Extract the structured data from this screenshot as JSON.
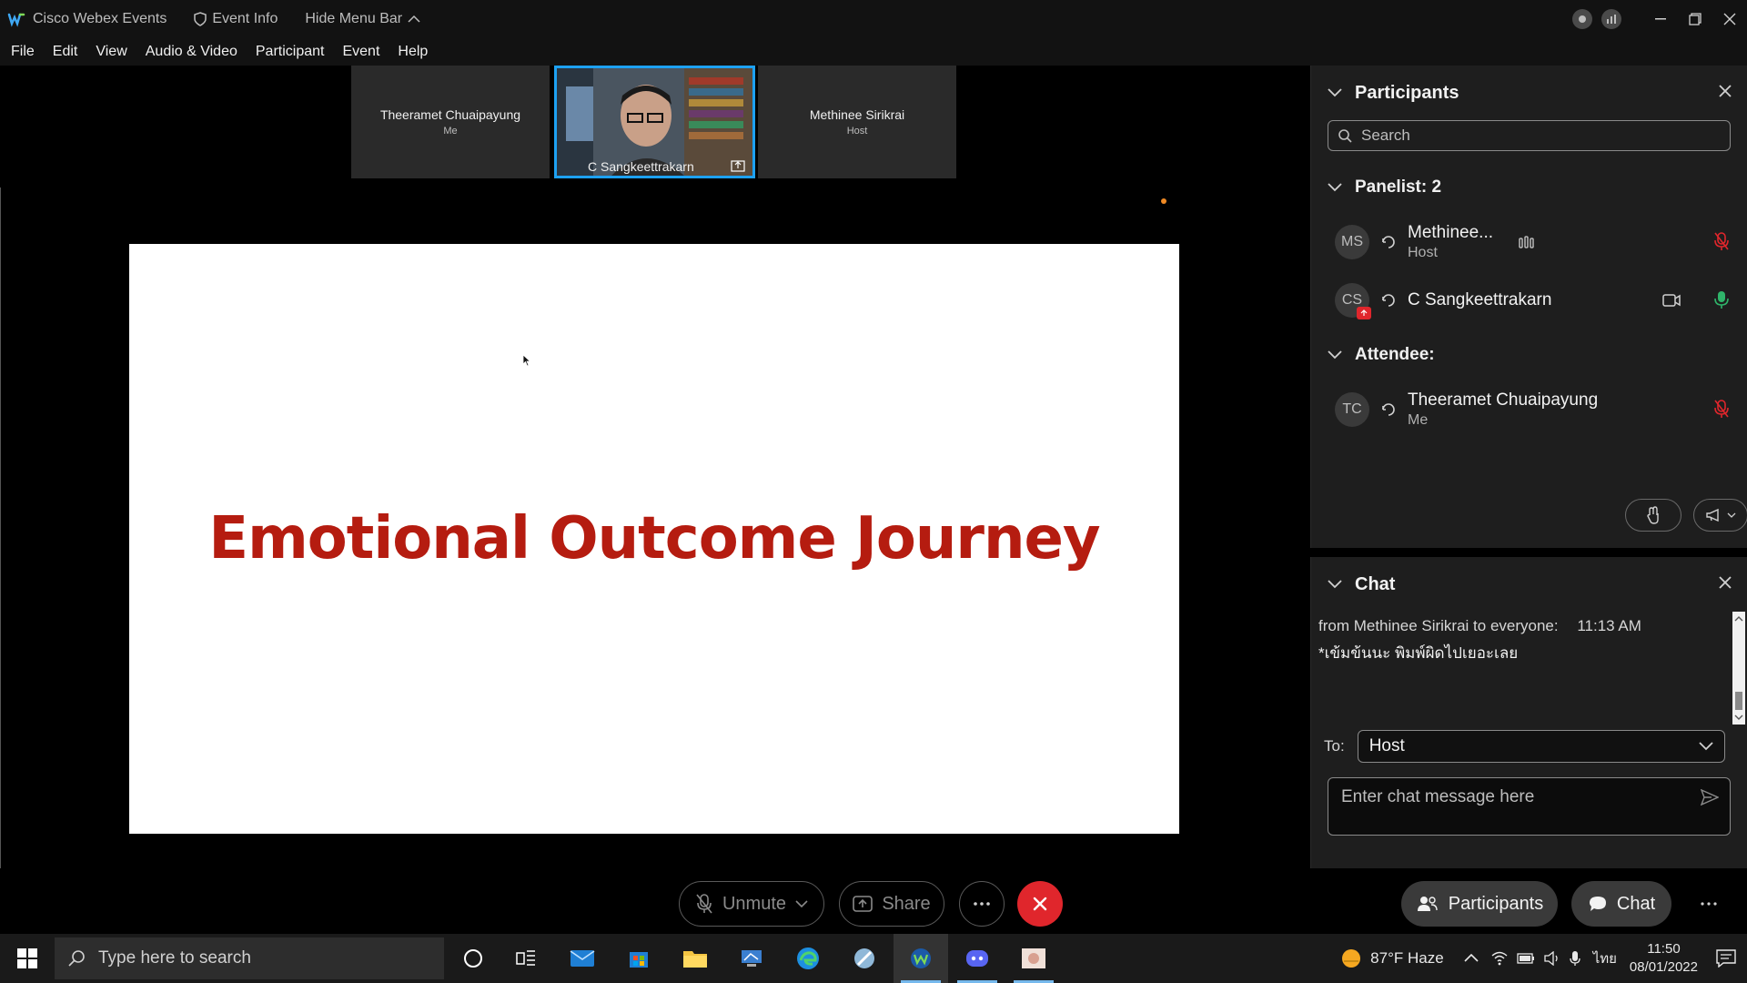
{
  "titlebar": {
    "app_name": "Cisco Webex Events",
    "event_info": "Event Info",
    "hide_menu": "Hide Menu Bar"
  },
  "menu": [
    "File",
    "Edit",
    "View",
    "Audio & Video",
    "Participant",
    "Event",
    "Help"
  ],
  "video_tiles": [
    {
      "name": "Theeramet Chuaipayung",
      "sub": "Me"
    },
    {
      "name": "C Sangkeettrakarn",
      "sub": ""
    },
    {
      "name": "Methinee Sirikrai",
      "sub": "Host"
    }
  ],
  "slide": {
    "title": "Emotional Outcome Journey"
  },
  "controls": {
    "unmute": "Unmute",
    "share": "Share",
    "participants": "Participants",
    "chat": "Chat"
  },
  "participants_panel": {
    "title": "Participants",
    "search_placeholder": "Search",
    "panelist_header": "Panelist: 2",
    "attendee_header": "Attendee:",
    "panelists": [
      {
        "initials": "MS",
        "name": "Methinee...",
        "role": "Host"
      },
      {
        "initials": "CS",
        "name": "C Sangkeettrakarn",
        "role": ""
      }
    ],
    "attendees": [
      {
        "initials": "TC",
        "name": "Theeramet Chuaipayung",
        "role": "Me"
      }
    ]
  },
  "chat_panel": {
    "title": "Chat",
    "message_meta": "from Methinee Sirikrai to everyone:",
    "message_time": "11:13 AM",
    "message_text": "*เข้มข้นนะ พิมพ์ผิดไปเยอะเลย",
    "to_label": "To:",
    "to_value": "Host",
    "input_placeholder": "Enter chat message here"
  },
  "taskbar": {
    "search_placeholder": "Type here to search",
    "weather": "87°F  Haze",
    "lang": "ไทย",
    "time": "11:50",
    "date": "08/01/2022"
  },
  "colors": {
    "accent": "#1da1f2",
    "end_call": "#e0262c",
    "slide_title": "#b51c10",
    "mic_on": "#2fb56a",
    "mic_off": "#e0262c"
  }
}
